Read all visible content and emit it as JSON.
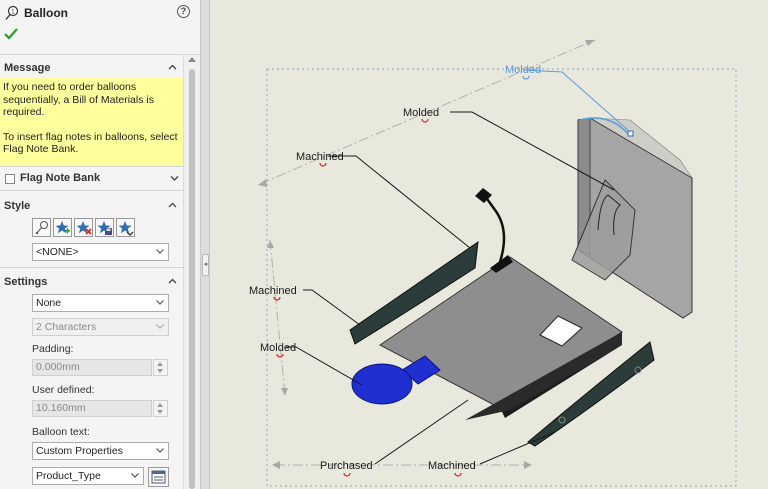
{
  "panel": {
    "title": "Balloon",
    "help_icon": "?",
    "message": {
      "heading": "Message",
      "para1": "If you need to order balloons sequentially, a Bill of Materials is required.",
      "para2": "To insert flag notes in balloons, select Flag Note Bank."
    },
    "flag_note_bank": {
      "label": "Flag Note Bank",
      "checked": false
    },
    "style": {
      "heading": "Style",
      "icons": [
        "balloon-style-icon",
        "star-add-icon",
        "star-remove-icon",
        "star-save-icon",
        "star-load-icon"
      ],
      "selected": "<NONE>"
    },
    "settings": {
      "heading": "Settings",
      "shape": "None",
      "size": "2 Characters",
      "padding_label": "Padding:",
      "padding_value": "0.000mm",
      "user_defined_label": "User defined:",
      "user_defined_value": "10.160mm",
      "balloon_text_label": "Balloon text:",
      "balloon_text_value": "Custom Properties",
      "property_value": "Product_Type"
    }
  },
  "viewport": {
    "balloons": {
      "molded_selected": "Molded",
      "molded_top": "Molded",
      "machined_left": "Machined",
      "machined_mid": "Machined",
      "molded_left": "Molded",
      "purchased": "Purchased",
      "machined_bottom": "Machined"
    },
    "colors": {
      "background": "#e9e8dd",
      "selected": "#5a9bdc",
      "attachment": "#d42020"
    }
  }
}
